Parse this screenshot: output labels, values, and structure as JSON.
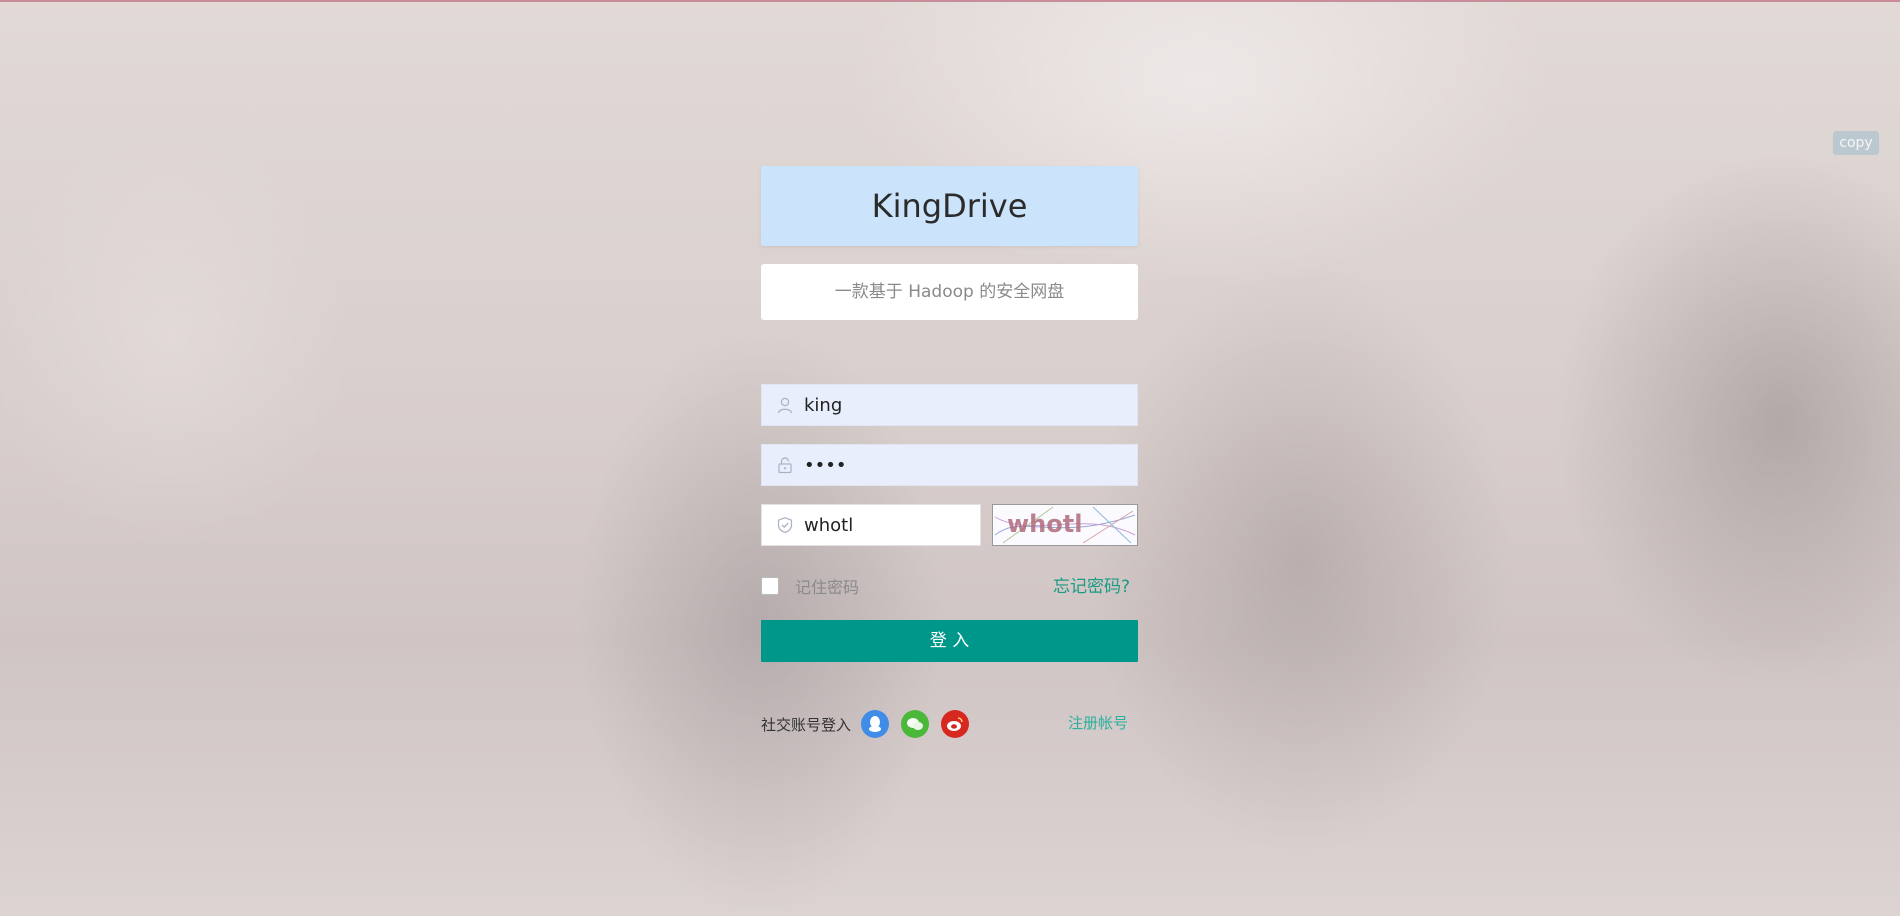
{
  "brand": {
    "title": "KingDrive"
  },
  "subtitle": "一款基于 Hadoop 的安全网盘",
  "copy_tag": "copy",
  "form": {
    "username": "king",
    "password_masked": "••••",
    "captcha_input": "whotl",
    "captcha_image_text": "whotl",
    "remember_label": "记住密码",
    "forgot_label": "忘记密码?",
    "login_label": "登 入"
  },
  "social": {
    "label": "社交账号登入",
    "providers": [
      "qq-icon",
      "wechat-icon",
      "weibo-icon"
    ],
    "register_label": "注册帐号"
  },
  "colors": {
    "brand_bg": "#cce4fb",
    "input_bg": "#e8eefb",
    "primary": "#00978b",
    "link": "#199b85",
    "qq": "#3f8de6",
    "wechat": "#4cb83a",
    "weibo": "#d7281f"
  }
}
